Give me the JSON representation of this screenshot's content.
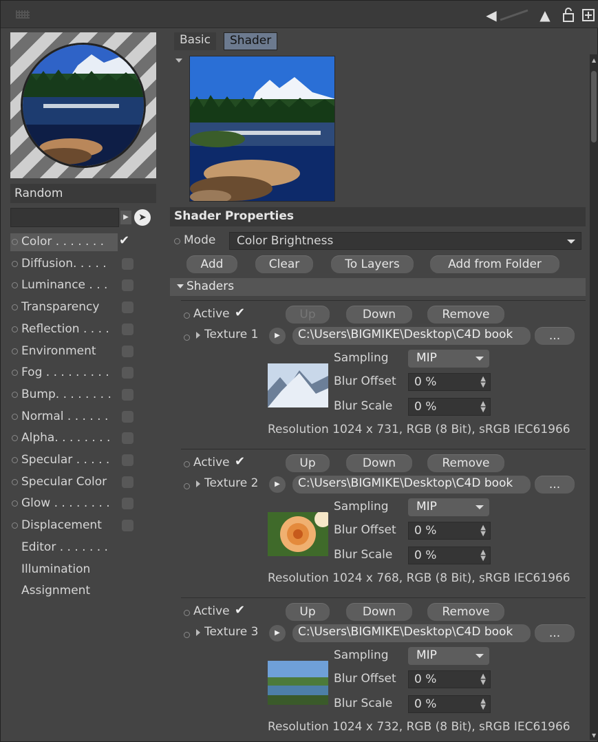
{
  "window": {
    "toolbar_icons": [
      "back-arrow-icon",
      "up-arrow-icon",
      "lock-icon",
      "new-window-icon"
    ]
  },
  "material": {
    "name": "Random",
    "channels": [
      {
        "label": "Color . . . . . . .",
        "enabled": true,
        "selected": true,
        "has_checkbox": true
      },
      {
        "label": "Diffusion. . . . .",
        "enabled": false,
        "has_checkbox": true
      },
      {
        "label": "Luminance . . .",
        "enabled": false,
        "has_checkbox": true
      },
      {
        "label": "Transparency",
        "enabled": false,
        "has_checkbox": true
      },
      {
        "label": "Reflection . . . .",
        "enabled": false,
        "has_checkbox": true
      },
      {
        "label": "Environment",
        "enabled": false,
        "has_checkbox": true
      },
      {
        "label": "Fog . . . . . . . . .",
        "enabled": false,
        "has_checkbox": true
      },
      {
        "label": "Bump. . . . . . . .",
        "enabled": false,
        "has_checkbox": true
      },
      {
        "label": "Normal . . . . . .",
        "enabled": false,
        "has_checkbox": true
      },
      {
        "label": "Alpha. . . . . . . .",
        "enabled": false,
        "has_checkbox": true
      },
      {
        "label": "Specular . . . . .",
        "enabled": false,
        "has_checkbox": true
      },
      {
        "label": "Specular Color",
        "enabled": false,
        "has_checkbox": true
      },
      {
        "label": "Glow . . . . . . . .",
        "enabled": false,
        "has_checkbox": true
      },
      {
        "label": "Displacement",
        "enabled": false,
        "has_checkbox": true
      },
      {
        "label": "Editor . . . . . . .",
        "has_checkbox": false
      },
      {
        "label": "Illumination",
        "has_checkbox": false
      },
      {
        "label": "Assignment",
        "has_checkbox": false
      }
    ]
  },
  "tabs": [
    {
      "label": "Basic",
      "active": false
    },
    {
      "label": "Shader",
      "active": true
    }
  ],
  "shader": {
    "section_title": "Shader Properties",
    "mode_label": "Mode",
    "mode_value": "Color Brightness",
    "buttons": {
      "add": "Add",
      "clear": "Clear",
      "to_layers": "To Layers",
      "add_from_folder": "Add from Folder"
    },
    "shaders_header": "Shaders",
    "textures": [
      {
        "active_label": "Active",
        "active": true,
        "up": "Up",
        "up_enabled": false,
        "down": "Down",
        "remove": "Remove",
        "name": "Texture 1",
        "path": "C:\\Users\\BIGMIKE\\Desktop\\C4D book",
        "browse": "...",
        "sampling_label": "Sampling",
        "sampling": "MIP",
        "blur_offset_label": "Blur Offset",
        "blur_offset": "0 %",
        "blur_scale_label": "Blur Scale",
        "blur_scale": "0 %",
        "resolution": "Resolution 1024 x 731, RGB (8 Bit), sRGB IEC61966"
      },
      {
        "active_label": "Active",
        "active": true,
        "up": "Up",
        "up_enabled": true,
        "down": "Down",
        "remove": "Remove",
        "name": "Texture 2",
        "path": "C:\\Users\\BIGMIKE\\Desktop\\C4D book",
        "browse": "...",
        "sampling_label": "Sampling",
        "sampling": "MIP",
        "blur_offset_label": "Blur Offset",
        "blur_offset": "0 %",
        "blur_scale_label": "Blur Scale",
        "blur_scale": "0 %",
        "resolution": "Resolution 1024 x 768, RGB (8 Bit), sRGB IEC61966"
      },
      {
        "active_label": "Active",
        "active": true,
        "up": "Up",
        "up_enabled": true,
        "down": "Down",
        "remove": "Remove",
        "name": "Texture 3",
        "path": "C:\\Users\\BIGMIKE\\Desktop\\C4D book",
        "browse": "...",
        "sampling_label": "Sampling",
        "sampling": "MIP",
        "blur_offset_label": "Blur Offset",
        "blur_offset": "0 %",
        "blur_scale_label": "Blur Scale",
        "blur_scale": "0 %",
        "resolution": "Resolution 1024 x 732, RGB (8 Bit), sRGB IEC61966"
      }
    ]
  },
  "colors": {
    "panel_bg": "#444444",
    "active_tab": "#6c7a8f",
    "button_bg": "#5d5d5d"
  }
}
